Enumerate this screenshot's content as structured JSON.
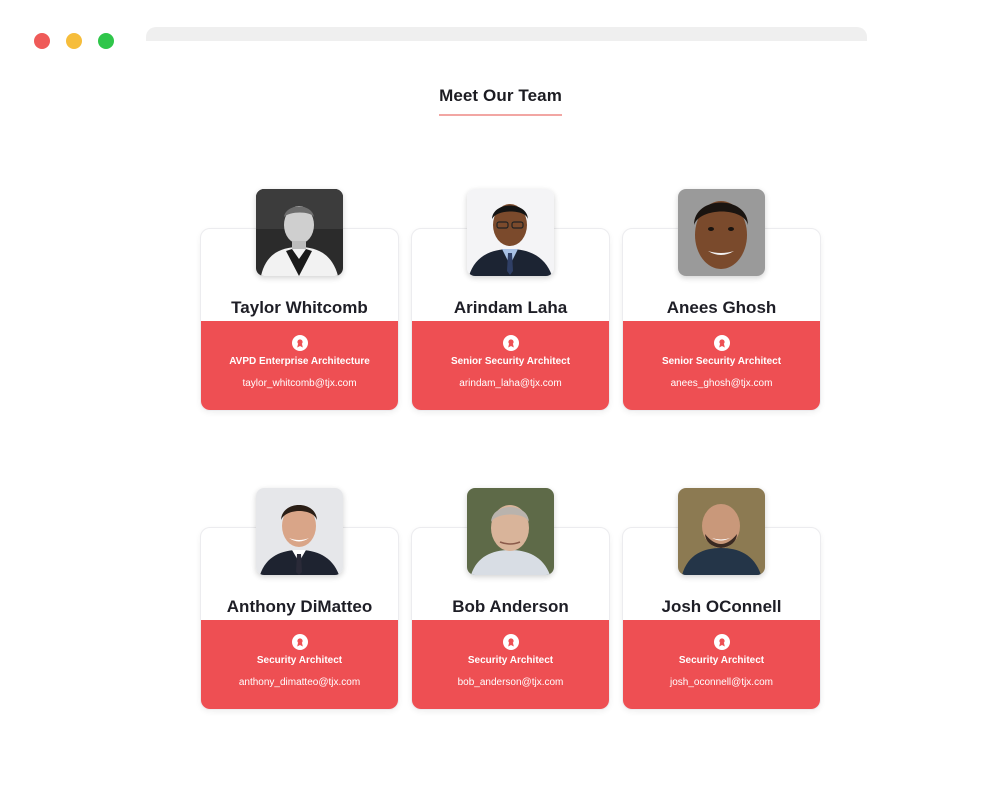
{
  "page": {
    "heading": "Meet Our Team"
  },
  "team": [
    {
      "name": "Taylor Whitcomb",
      "title": "AVPD Enterprise Architecture",
      "email": "taylor_whitcomb@tjx.com"
    },
    {
      "name": "Arindam Laha",
      "title": "Senior Security Architect",
      "email": "arindam_laha@tjx.com"
    },
    {
      "name": "Anees Ghosh",
      "title": "Senior Security Architect",
      "email": "anees_ghosh@tjx.com"
    },
    {
      "name": "Anthony DiMatteo",
      "title": "Security Architect",
      "email": "anthony_dimatteo@tjx.com"
    },
    {
      "name": "Bob Anderson",
      "title": "Security Architect",
      "email": "bob_anderson@tjx.com"
    },
    {
      "name": "Josh OConnell",
      "title": "Security Architect",
      "email": "josh_oconnell@tjx.com"
    }
  ],
  "icons": {
    "badge": "award-icon"
  },
  "colors": {
    "accent": "#ee4f53",
    "underline": "#f2a6a3"
  }
}
